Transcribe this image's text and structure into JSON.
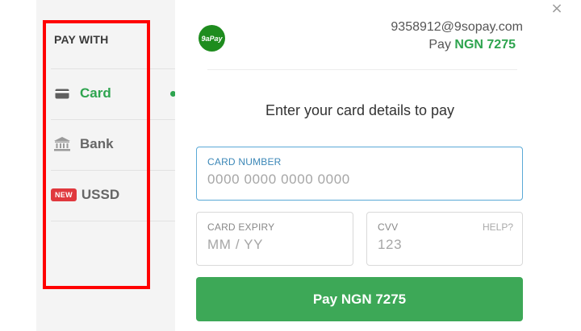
{
  "window": {
    "close_glyph": "×"
  },
  "sidebar": {
    "heading": "PAY WITH",
    "items": [
      {
        "label": "Card",
        "icon": "card-icon",
        "active": true
      },
      {
        "label": "Bank",
        "icon": "bank-icon",
        "active": false
      },
      {
        "label": "USSD",
        "icon": "new-badge",
        "badge": "NEW",
        "active": false
      }
    ]
  },
  "header": {
    "logo_text": "9aPay",
    "email": "9358912@9sopay.com",
    "pay_prefix": "Pay",
    "amount": "NGN 7275"
  },
  "form": {
    "instruction": "Enter your card details to pay",
    "card_number": {
      "label": "CARD NUMBER",
      "placeholder": "0000 0000 0000 0000",
      "value": ""
    },
    "card_expiry": {
      "label": "CARD EXPIRY",
      "placeholder": "MM / YY",
      "value": ""
    },
    "cvv": {
      "label": "CVV",
      "placeholder": "123",
      "value": "",
      "help": "HELP?"
    },
    "submit_label": "Pay NGN 7275"
  },
  "colors": {
    "accent_green": "#2ea44f",
    "button_green": "#3da857",
    "focus_blue": "#5aa9d6",
    "badge_red": "#e0383e",
    "highlight_red": "#ff0000"
  }
}
